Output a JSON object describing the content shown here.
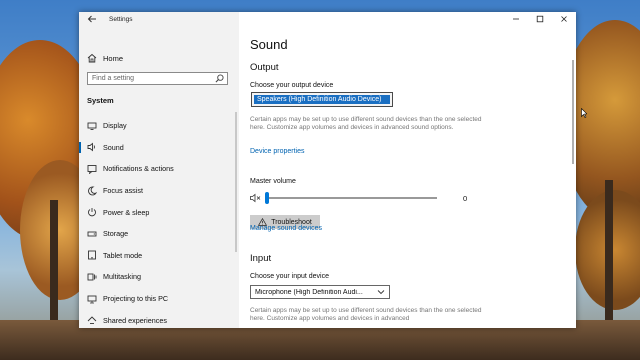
{
  "window": {
    "title": "Settings"
  },
  "sidebar": {
    "home_label": "Home",
    "search_placeholder": "Find a setting",
    "section": "System",
    "items": [
      {
        "label": "Display",
        "icon": "display-icon"
      },
      {
        "label": "Sound",
        "icon": "speaker-icon",
        "active": true
      },
      {
        "label": "Notifications & actions",
        "icon": "notifications-icon"
      },
      {
        "label": "Focus assist",
        "icon": "moon-icon"
      },
      {
        "label": "Power & sleep",
        "icon": "power-icon"
      },
      {
        "label": "Storage",
        "icon": "storage-icon"
      },
      {
        "label": "Tablet mode",
        "icon": "tablet-icon"
      },
      {
        "label": "Multitasking",
        "icon": "multitasking-icon"
      },
      {
        "label": "Projecting to this PC",
        "icon": "projecting-icon"
      },
      {
        "label": "Shared experiences",
        "icon": "shared-icon"
      }
    ]
  },
  "main": {
    "title": "Sound",
    "output": {
      "heading": "Output",
      "choose_label": "Choose your output device",
      "selected_device": "Speakers (High Definition Audio Device)",
      "description": "Certain apps may be set up to use different sound devices than the one selected here. Customize app volumes and devices in advanced sound options.",
      "device_properties": "Device properties",
      "master_volume_label": "Master volume",
      "volume_value": "0",
      "volume_level": 0,
      "troubleshoot": "Troubleshoot",
      "manage_devices": "Manage sound devices"
    },
    "input": {
      "heading": "Input",
      "choose_label": "Choose your input device",
      "selected_device": "Microphone (High Definition Audi...",
      "description": "Certain apps may be set up to use different sound devices than the one selected here. Customize app volumes and devices in advanced"
    }
  },
  "colors": {
    "accent": "#0078d7",
    "link": "#0063b1",
    "selection": "#1a6fc2"
  }
}
